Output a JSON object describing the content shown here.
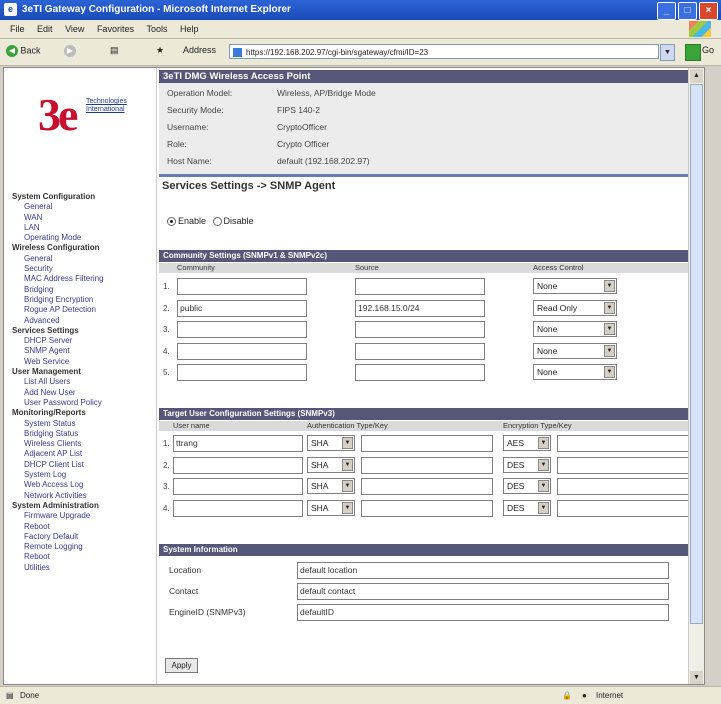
{
  "window": {
    "title": "3eTI Gateway Configuration - Microsoft Internet Explorer"
  },
  "menu": [
    "File",
    "Edit",
    "View",
    "Favorites",
    "Tools",
    "Help"
  ],
  "toolbar": {
    "back_label": "Back",
    "address_label": "Address",
    "url": "https://192.168.202.97/cgi-bin/sgateway/cfmi/ID=23",
    "go_label": "Go"
  },
  "brand": {
    "logo_text": "3e",
    "logo_sub": "Technologies International",
    "accent": "#c8102e"
  },
  "sidebar": [
    {
      "label": "System Configuration",
      "type": "h"
    },
    {
      "label": "General",
      "type": "i"
    },
    {
      "label": "WAN",
      "type": "i"
    },
    {
      "label": "LAN",
      "type": "i"
    },
    {
      "label": "Operating Mode",
      "type": "i"
    },
    {
      "label": "Wireless Configuration",
      "type": "h"
    },
    {
      "label": "General",
      "type": "i"
    },
    {
      "label": "Security",
      "type": "i"
    },
    {
      "label": "MAC Address Filtering",
      "type": "i"
    },
    {
      "label": "Bridging",
      "type": "i"
    },
    {
      "label": "Bridging Encryption",
      "type": "i"
    },
    {
      "label": "Rogue AP Detection",
      "type": "i"
    },
    {
      "label": "Advanced",
      "type": "i"
    },
    {
      "label": "Services Settings",
      "type": "h"
    },
    {
      "label": "DHCP Server",
      "type": "i"
    },
    {
      "label": "SNMP Agent",
      "type": "i"
    },
    {
      "label": "Web Service",
      "type": "i"
    },
    {
      "label": "User Management",
      "type": "h"
    },
    {
      "label": "List All Users",
      "type": "i"
    },
    {
      "label": "Add New User",
      "type": "i"
    },
    {
      "label": "User Password Policy",
      "type": "i"
    },
    {
      "label": "Monitoring/Reports",
      "type": "h"
    },
    {
      "label": "System Status",
      "type": "i"
    },
    {
      "label": "Bridging Status",
      "type": "i"
    },
    {
      "label": "Wireless Clients",
      "type": "i"
    },
    {
      "label": "Adjacent AP List",
      "type": "i"
    },
    {
      "label": "DHCP Client List",
      "type": "i"
    },
    {
      "label": "System Log",
      "type": "i"
    },
    {
      "label": "Web Access Log",
      "type": "i"
    },
    {
      "label": "Network Activities",
      "type": "i"
    },
    {
      "label": "System Administration",
      "type": "h"
    },
    {
      "label": "Firmware Upgrade",
      "type": "i"
    },
    {
      "label": "Reboot",
      "type": "i"
    },
    {
      "label": "Factory Default",
      "type": "i"
    },
    {
      "label": "Remote Logging",
      "type": "i"
    },
    {
      "label": "Reboot",
      "type": "i"
    },
    {
      "label": "Utilities",
      "type": "i"
    }
  ],
  "header": {
    "title": "3eTI DMG Wireless Access Point"
  },
  "info": [
    {
      "label": "Operation Model:",
      "value": "Wireless, AP/Bridge Mode"
    },
    {
      "label": "Security Mode:",
      "value": "FIPS 140-2"
    },
    {
      "label": "Username:",
      "value": "CryptoOfficer"
    },
    {
      "label": "Role:",
      "value": "Crypto Officer"
    },
    {
      "label": "Host Name:",
      "value": "default (192.168.202.97)"
    }
  ],
  "page_title": "Services Settings -> SNMP Agent",
  "enable": {
    "enable_label": "Enable",
    "disable_label": "Disable",
    "selected": "enable"
  },
  "community": {
    "title": "Community Settings (SNMPv1 & SNMPv2c)",
    "headers": [
      "Community",
      "Source",
      "Access Control"
    ],
    "rows": [
      {
        "num": "1.",
        "community": "",
        "source": "",
        "access": "None"
      },
      {
        "num": "2.",
        "community": "public",
        "source": "192.168.15.0/24",
        "access": "Read Only"
      },
      {
        "num": "3.",
        "community": "",
        "source": "",
        "access": "None"
      },
      {
        "num": "4.",
        "community": "",
        "source": "",
        "access": "None"
      },
      {
        "num": "5.",
        "community": "",
        "source": "",
        "access": "None"
      }
    ]
  },
  "snmpv3": {
    "title": "Target User Configuration Settings (SNMPv3)",
    "headers": [
      "User name",
      "Authentication Type/Key",
      "Encryption Type/Key"
    ],
    "rows": [
      {
        "num": "1.",
        "user": "ttrang",
        "auth": "SHA",
        "enc": "AES"
      },
      {
        "num": "2.",
        "user": "",
        "auth": "SHA",
        "enc": "DES"
      },
      {
        "num": "3.",
        "user": "",
        "auth": "SHA",
        "enc": "DES"
      },
      {
        "num": "4.",
        "user": "",
        "auth": "SHA",
        "enc": "DES"
      }
    ]
  },
  "sysinfo": {
    "title": "System Information",
    "rows": [
      {
        "label": "Location",
        "value": "default location"
      },
      {
        "label": "Contact",
        "value": "default contact"
      },
      {
        "label": "EngineID (SNMPv3)",
        "value": "defaultID"
      }
    ]
  },
  "apply_label": "Apply",
  "status": {
    "left": "Done",
    "zone": "Internet"
  }
}
